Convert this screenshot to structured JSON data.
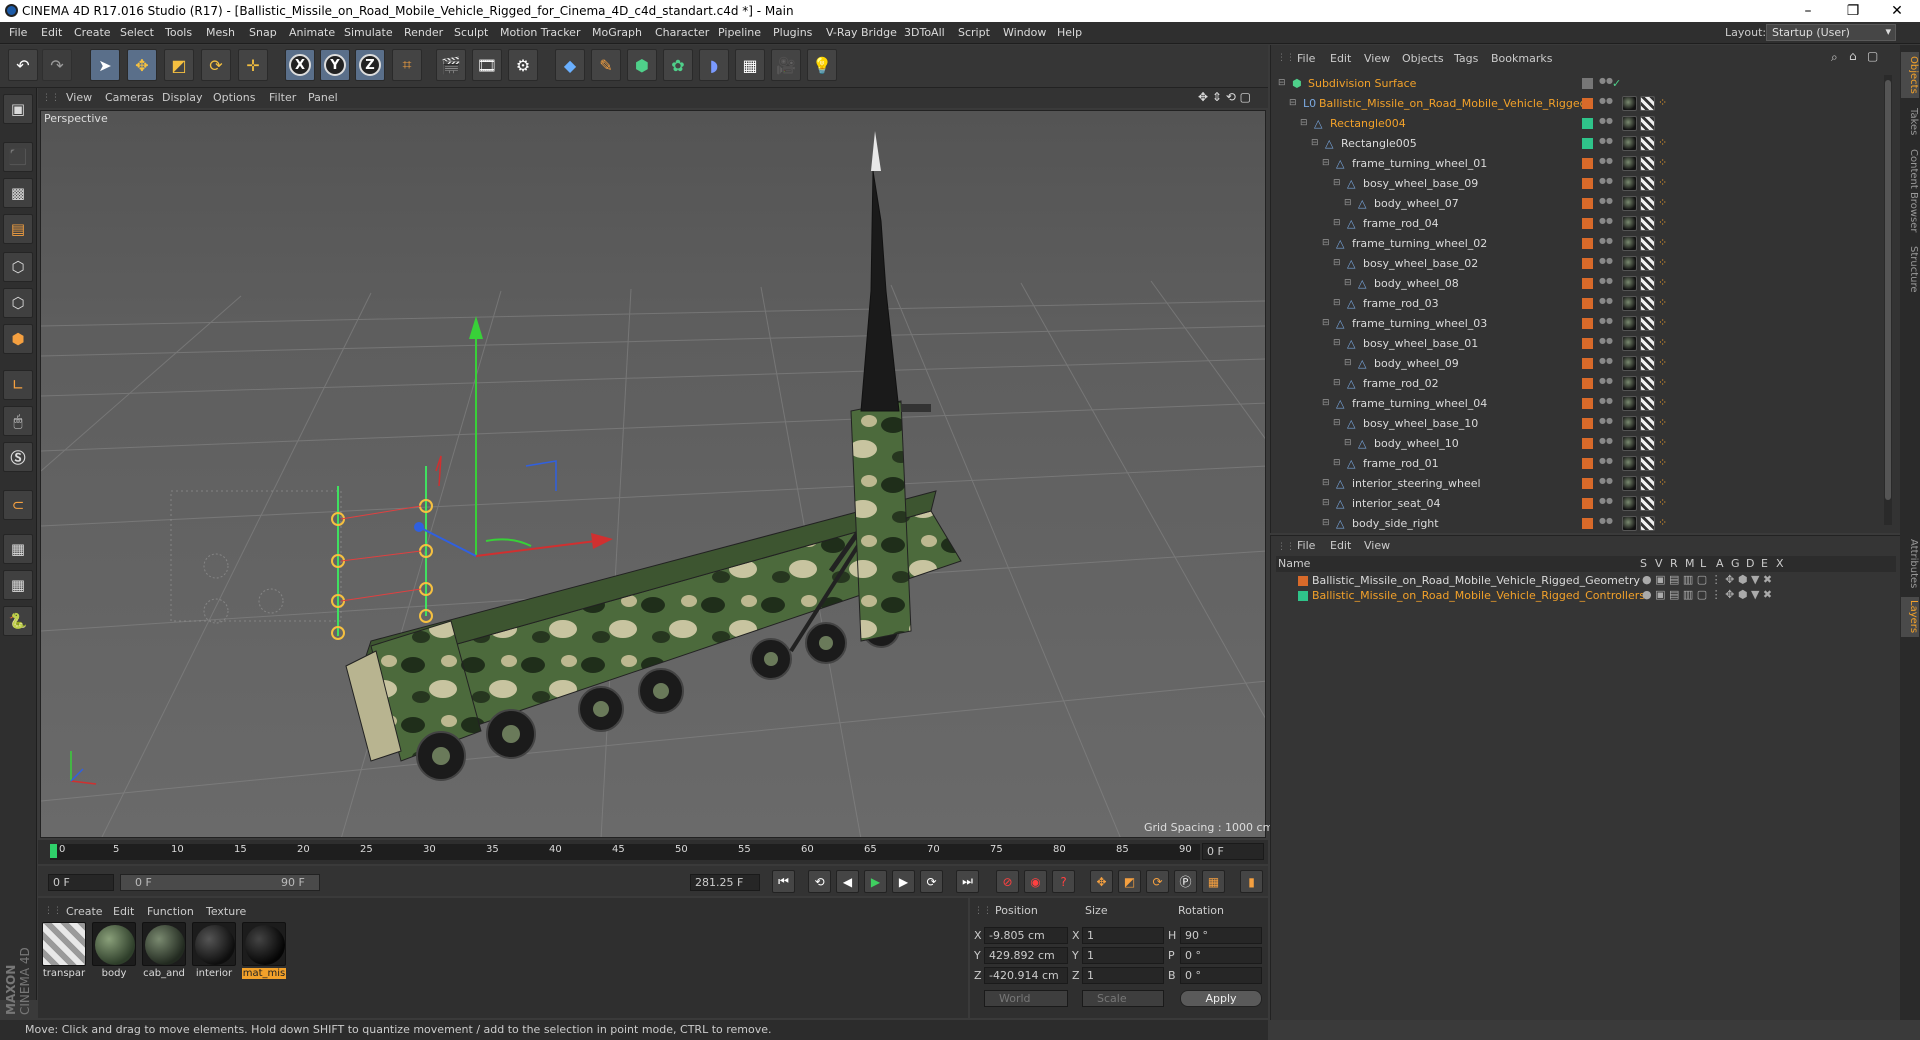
{
  "window": {
    "title": "CINEMA 4D R17.016 Studio (R17) - [Ballistic_Missile_on_Road_Mobile_Vehicle_Rigged_for_Cinema_4D_c4d_standart.c4d *] - Main",
    "minimize": "–",
    "restore": "❐",
    "close": "✕"
  },
  "menubar": {
    "items": [
      "File",
      "Edit",
      "Create",
      "Select",
      "Tools",
      "Mesh",
      "Snap",
      "Animate",
      "Simulate",
      "Render",
      "Sculpt",
      "Motion Tracker",
      "MoGraph",
      "Character",
      "Pipeline",
      "Plugins",
      "V-Ray Bridge",
      "3DToAll",
      "Script",
      "Window",
      "Help"
    ],
    "layout_label": "Layout:",
    "layout_value": "Startup (User)"
  },
  "viewport": {
    "menu": [
      "View",
      "Cameras",
      "Display",
      "Options",
      "Filter",
      "Panel"
    ],
    "label": "Perspective",
    "grid_spacing": "Grid Spacing : 1000 cm"
  },
  "timeline": {
    "ticks": [
      "0",
      "5",
      "10",
      "15",
      "20",
      "25",
      "30",
      "35",
      "40",
      "45",
      "50",
      "55",
      "60",
      "65",
      "70",
      "75",
      "80",
      "85",
      "90"
    ],
    "current_frame_field": "0 F",
    "start_field": "0 F",
    "range_start": "0 F",
    "range_end": "90 F",
    "end_field": "281.25 F"
  },
  "materials": {
    "menu": [
      "Create",
      "Edit",
      "Function",
      "Texture"
    ],
    "items": [
      {
        "name": "transpar",
        "color": "#cfcfcf"
      },
      {
        "name": "body",
        "color": "#5a6e5a"
      },
      {
        "name": "cab_and",
        "color": "#4a5a4a"
      },
      {
        "name": "interior",
        "color": "#2a2a2a"
      },
      {
        "name": "mat_mis",
        "color": "#1a1a1a",
        "selected": true
      }
    ]
  },
  "coordinates": {
    "headers": [
      "Position",
      "Size",
      "Rotation"
    ],
    "rows": [
      {
        "axis": "X",
        "pos": "-9.805 cm",
        "size_axis": "X",
        "size": "1",
        "rot_axis": "H",
        "rot": "90 °"
      },
      {
        "axis": "Y",
        "pos": "429.892 cm",
        "size_axis": "Y",
        "size": "1",
        "rot_axis": "P",
        "rot": "0 °"
      },
      {
        "axis": "Z",
        "pos": "-420.914 cm",
        "size_axis": "Z",
        "size": "1",
        "rot_axis": "B",
        "rot": "0 °"
      }
    ],
    "mode1": "World",
    "mode2": "Scale",
    "apply": "Apply"
  },
  "status": "Move: Click and drag to move elements. Hold down SHIFT to quantize movement / add to the selection in point mode, CTRL to remove.",
  "object_manager": {
    "menu": [
      "File",
      "Edit",
      "View",
      "Objects",
      "Tags",
      "Bookmarks"
    ],
    "objects": [
      {
        "name": "Subdivision Surface",
        "indent": 0,
        "color": "#f2a12a",
        "dot": "#777"
      },
      {
        "name": "Ballistic_Missile_on_Road_Mobile_Vehicle_Rigged",
        "indent": 1,
        "color": "#f2a12a",
        "dot": "#d86a2a"
      },
      {
        "name": "Rectangle004",
        "indent": 2,
        "color": "#f2a12a",
        "dot": "#2fc48a"
      },
      {
        "name": "Rectangle005",
        "indent": 3,
        "color": "#dadada",
        "dot": "#2fc48a"
      },
      {
        "name": "frame_turning_wheel_01",
        "indent": 4,
        "color": "#dadada",
        "dot": "#d86a2a"
      },
      {
        "name": "bosy_wheel_base_09",
        "indent": 5,
        "color": "#dadada",
        "dot": "#d86a2a"
      },
      {
        "name": "body_wheel_07",
        "indent": 6,
        "color": "#dadada",
        "dot": "#d86a2a"
      },
      {
        "name": "frame_rod_04",
        "indent": 5,
        "color": "#dadada",
        "dot": "#d86a2a"
      },
      {
        "name": "frame_turning_wheel_02",
        "indent": 4,
        "color": "#dadada",
        "dot": "#d86a2a"
      },
      {
        "name": "bosy_wheel_base_02",
        "indent": 5,
        "color": "#dadada",
        "dot": "#d86a2a"
      },
      {
        "name": "body_wheel_08",
        "indent": 6,
        "color": "#dadada",
        "dot": "#d86a2a"
      },
      {
        "name": "frame_rod_03",
        "indent": 5,
        "color": "#dadada",
        "dot": "#d86a2a"
      },
      {
        "name": "frame_turning_wheel_03",
        "indent": 4,
        "color": "#dadada",
        "dot": "#d86a2a"
      },
      {
        "name": "bosy_wheel_base_01",
        "indent": 5,
        "color": "#dadada",
        "dot": "#d86a2a"
      },
      {
        "name": "body_wheel_09",
        "indent": 6,
        "color": "#dadada",
        "dot": "#d86a2a"
      },
      {
        "name": "frame_rod_02",
        "indent": 5,
        "color": "#dadada",
        "dot": "#d86a2a"
      },
      {
        "name": "frame_turning_wheel_04",
        "indent": 4,
        "color": "#dadada",
        "dot": "#d86a2a"
      },
      {
        "name": "bosy_wheel_base_10",
        "indent": 5,
        "color": "#dadada",
        "dot": "#d86a2a"
      },
      {
        "name": "body_wheel_10",
        "indent": 6,
        "color": "#dadada",
        "dot": "#d86a2a"
      },
      {
        "name": "frame_rod_01",
        "indent": 5,
        "color": "#dadada",
        "dot": "#d86a2a"
      },
      {
        "name": "interior_steering_wheel",
        "indent": 4,
        "color": "#dadada",
        "dot": "#d86a2a"
      },
      {
        "name": "interior_seat_04",
        "indent": 4,
        "color": "#dadada",
        "dot": "#d86a2a"
      },
      {
        "name": "body_side_right",
        "indent": 4,
        "color": "#dadada",
        "dot": "#d86a2a"
      }
    ]
  },
  "layer_manager": {
    "menu": [
      "File",
      "Edit",
      "View"
    ],
    "header_name": "Name",
    "header_cols": [
      "S",
      "V",
      "R",
      "M",
      "L",
      "A",
      "G",
      "D",
      "E",
      "X"
    ],
    "layers": [
      {
        "name": "Ballistic_Missile_on_Road_Mobile_Vehicle_Rigged_Geometry",
        "color": "#d86a2a",
        "text_color": "#dadada"
      },
      {
        "name": "Ballistic_Missile_on_Road_Mobile_Vehicle_Rigged_Controllers",
        "color": "#2fc48a",
        "text_color": "#f2a12a"
      }
    ]
  },
  "side_tabs": [
    "Objects",
    "Takes",
    "Content Browser",
    "Structure",
    "Attributes",
    "Layers"
  ],
  "brand": {
    "line1": "MAXON",
    "line2": "CINEMA 4D"
  }
}
